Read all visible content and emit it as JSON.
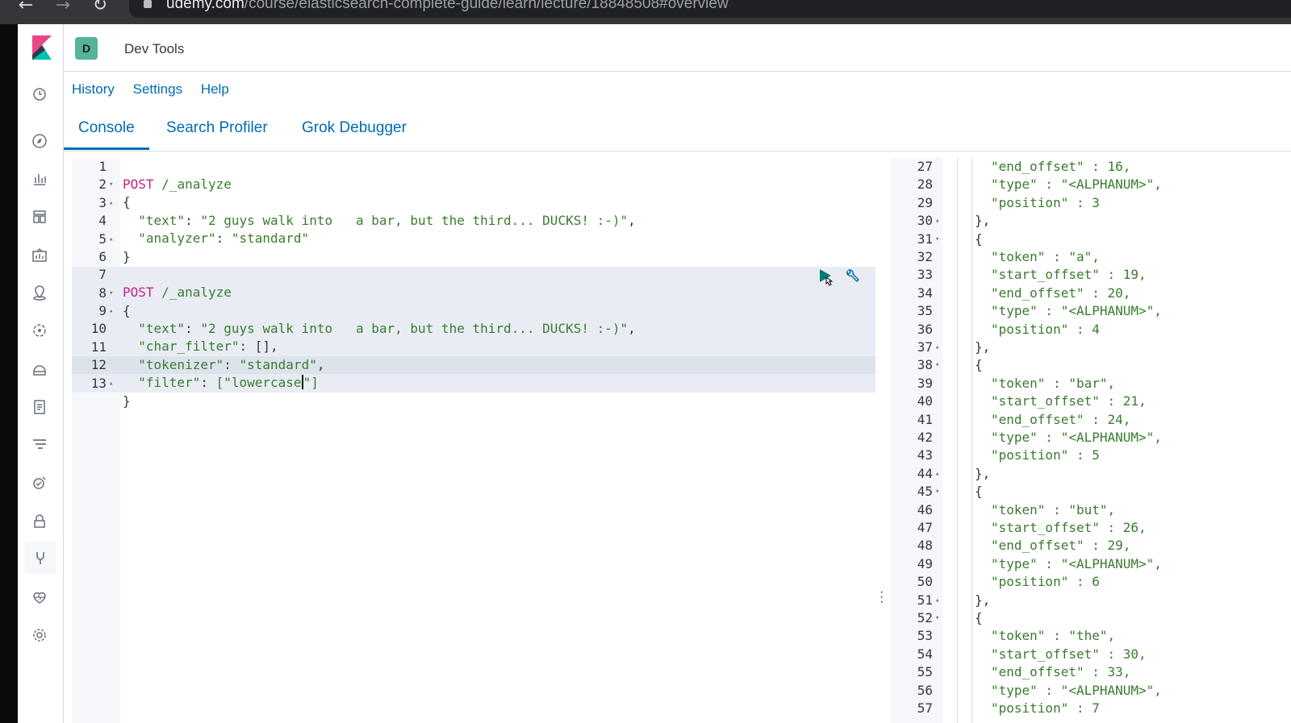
{
  "browser": {
    "url_host": "udemy.com",
    "url_path": "/course/elasticsearch-complete-guide/learn/lecture/18848508#overview"
  },
  "app": {
    "space_initial": "D",
    "title": "Dev Tools"
  },
  "menu": {
    "history": "History",
    "settings": "Settings",
    "help": "Help"
  },
  "tabs": {
    "console": "Console",
    "search_profiler": "Search Profiler",
    "grok_debugger": "Grok Debugger"
  },
  "editor": {
    "line_numbers": [
      "1",
      "2",
      "3",
      "4",
      "5",
      "6",
      "7",
      "8",
      "9",
      "10",
      "11",
      "12",
      "13"
    ],
    "fold_markers": [
      "",
      "▾",
      "▴",
      "",
      "▴",
      "",
      "",
      "▾",
      "▴",
      "",
      "",
      "",
      "▴"
    ],
    "request1": {
      "method": "POST",
      "path": "/_analyze",
      "open_brace": "{",
      "text_key": "\"text\"",
      "text_value": "\"2 guys walk into   a bar, but the third... DUCKS! :-)\"",
      "analyzer_key": "\"analyzer\"",
      "analyzer_value": "\"standard\"",
      "close_brace": "}"
    },
    "request2": {
      "method": "POST",
      "path": "/_analyze",
      "open_brace": "{",
      "text_key": "\"text\"",
      "text_value": "\"2 guys walk into   a bar, but the third... DUCKS! :-)\"",
      "char_filter_key": "\"char_filter\"",
      "char_filter_value": "[]",
      "tokenizer_key": "\"tokenizer\"",
      "tokenizer_value": "\"standard\"",
      "filter_key": "\"filter\"",
      "filter_value_before_caret": "[\"lowercase",
      "filter_value_after_caret": "\"]",
      "close_brace": "}"
    }
  },
  "output": {
    "lines": [
      {
        "n": "27",
        "fold": "",
        "indent": 2,
        "text": "\"end_offset\" : 16,"
      },
      {
        "n": "28",
        "fold": "",
        "indent": 2,
        "text": "\"type\" : \"<ALPHANUM>\","
      },
      {
        "n": "29",
        "fold": "",
        "indent": 2,
        "text": "\"position\" : 3"
      },
      {
        "n": "30",
        "fold": "▴",
        "indent": 1,
        "text": "},"
      },
      {
        "n": "31",
        "fold": "▾",
        "indent": 1,
        "text": "{"
      },
      {
        "n": "32",
        "fold": "",
        "indent": 2,
        "text": "\"token\" : \"a\","
      },
      {
        "n": "33",
        "fold": "",
        "indent": 2,
        "text": "\"start_offset\" : 19,"
      },
      {
        "n": "34",
        "fold": "",
        "indent": 2,
        "text": "\"end_offset\" : 20,"
      },
      {
        "n": "35",
        "fold": "",
        "indent": 2,
        "text": "\"type\" : \"<ALPHANUM>\","
      },
      {
        "n": "36",
        "fold": "",
        "indent": 2,
        "text": "\"position\" : 4"
      },
      {
        "n": "37",
        "fold": "▴",
        "indent": 1,
        "text": "},"
      },
      {
        "n": "38",
        "fold": "▾",
        "indent": 1,
        "text": "{"
      },
      {
        "n": "39",
        "fold": "",
        "indent": 2,
        "text": "\"token\" : \"bar\","
      },
      {
        "n": "40",
        "fold": "",
        "indent": 2,
        "text": "\"start_offset\" : 21,"
      },
      {
        "n": "41",
        "fold": "",
        "indent": 2,
        "text": "\"end_offset\" : 24,"
      },
      {
        "n": "42",
        "fold": "",
        "indent": 2,
        "text": "\"type\" : \"<ALPHANUM>\","
      },
      {
        "n": "43",
        "fold": "",
        "indent": 2,
        "text": "\"position\" : 5"
      },
      {
        "n": "44",
        "fold": "▴",
        "indent": 1,
        "text": "},"
      },
      {
        "n": "45",
        "fold": "▾",
        "indent": 1,
        "text": "{"
      },
      {
        "n": "46",
        "fold": "",
        "indent": 2,
        "text": "\"token\" : \"but\","
      },
      {
        "n": "47",
        "fold": "",
        "indent": 2,
        "text": "\"start_offset\" : 26,"
      },
      {
        "n": "48",
        "fold": "",
        "indent": 2,
        "text": "\"end_offset\" : 29,"
      },
      {
        "n": "49",
        "fold": "",
        "indent": 2,
        "text": "\"type\" : \"<ALPHANUM>\","
      },
      {
        "n": "50",
        "fold": "",
        "indent": 2,
        "text": "\"position\" : 6"
      },
      {
        "n": "51",
        "fold": "▴",
        "indent": 1,
        "text": "},"
      },
      {
        "n": "52",
        "fold": "▾",
        "indent": 1,
        "text": "{"
      },
      {
        "n": "53",
        "fold": "",
        "indent": 2,
        "text": "\"token\" : \"the\","
      },
      {
        "n": "54",
        "fold": "",
        "indent": 2,
        "text": "\"start_offset\" : 30,"
      },
      {
        "n": "55",
        "fold": "",
        "indent": 2,
        "text": "\"end_offset\" : 33,"
      },
      {
        "n": "56",
        "fold": "",
        "indent": 2,
        "text": "\"type\" : \"<ALPHANUM>\","
      },
      {
        "n": "57",
        "fold": "",
        "indent": 2,
        "text": "\"position\" : 7"
      }
    ]
  },
  "icons": {
    "sidebar": [
      "clock-icon",
      "compass-icon",
      "visualize-icon",
      "dashboard-icon",
      "canvas-icon",
      "maps-icon",
      "ml-icon",
      "infrastructure-icon",
      "logs-icon",
      "apm-icon",
      "uptime-icon",
      "siem-icon",
      "dev-tools-icon",
      "monitoring-icon",
      "management-icon"
    ],
    "run": "play-icon",
    "settings": "wrench-icon"
  },
  "colors": {
    "accent": "#006bb4",
    "method": "#c61e8a",
    "string": "#3a7c2f",
    "space_badge": "#54b399"
  }
}
